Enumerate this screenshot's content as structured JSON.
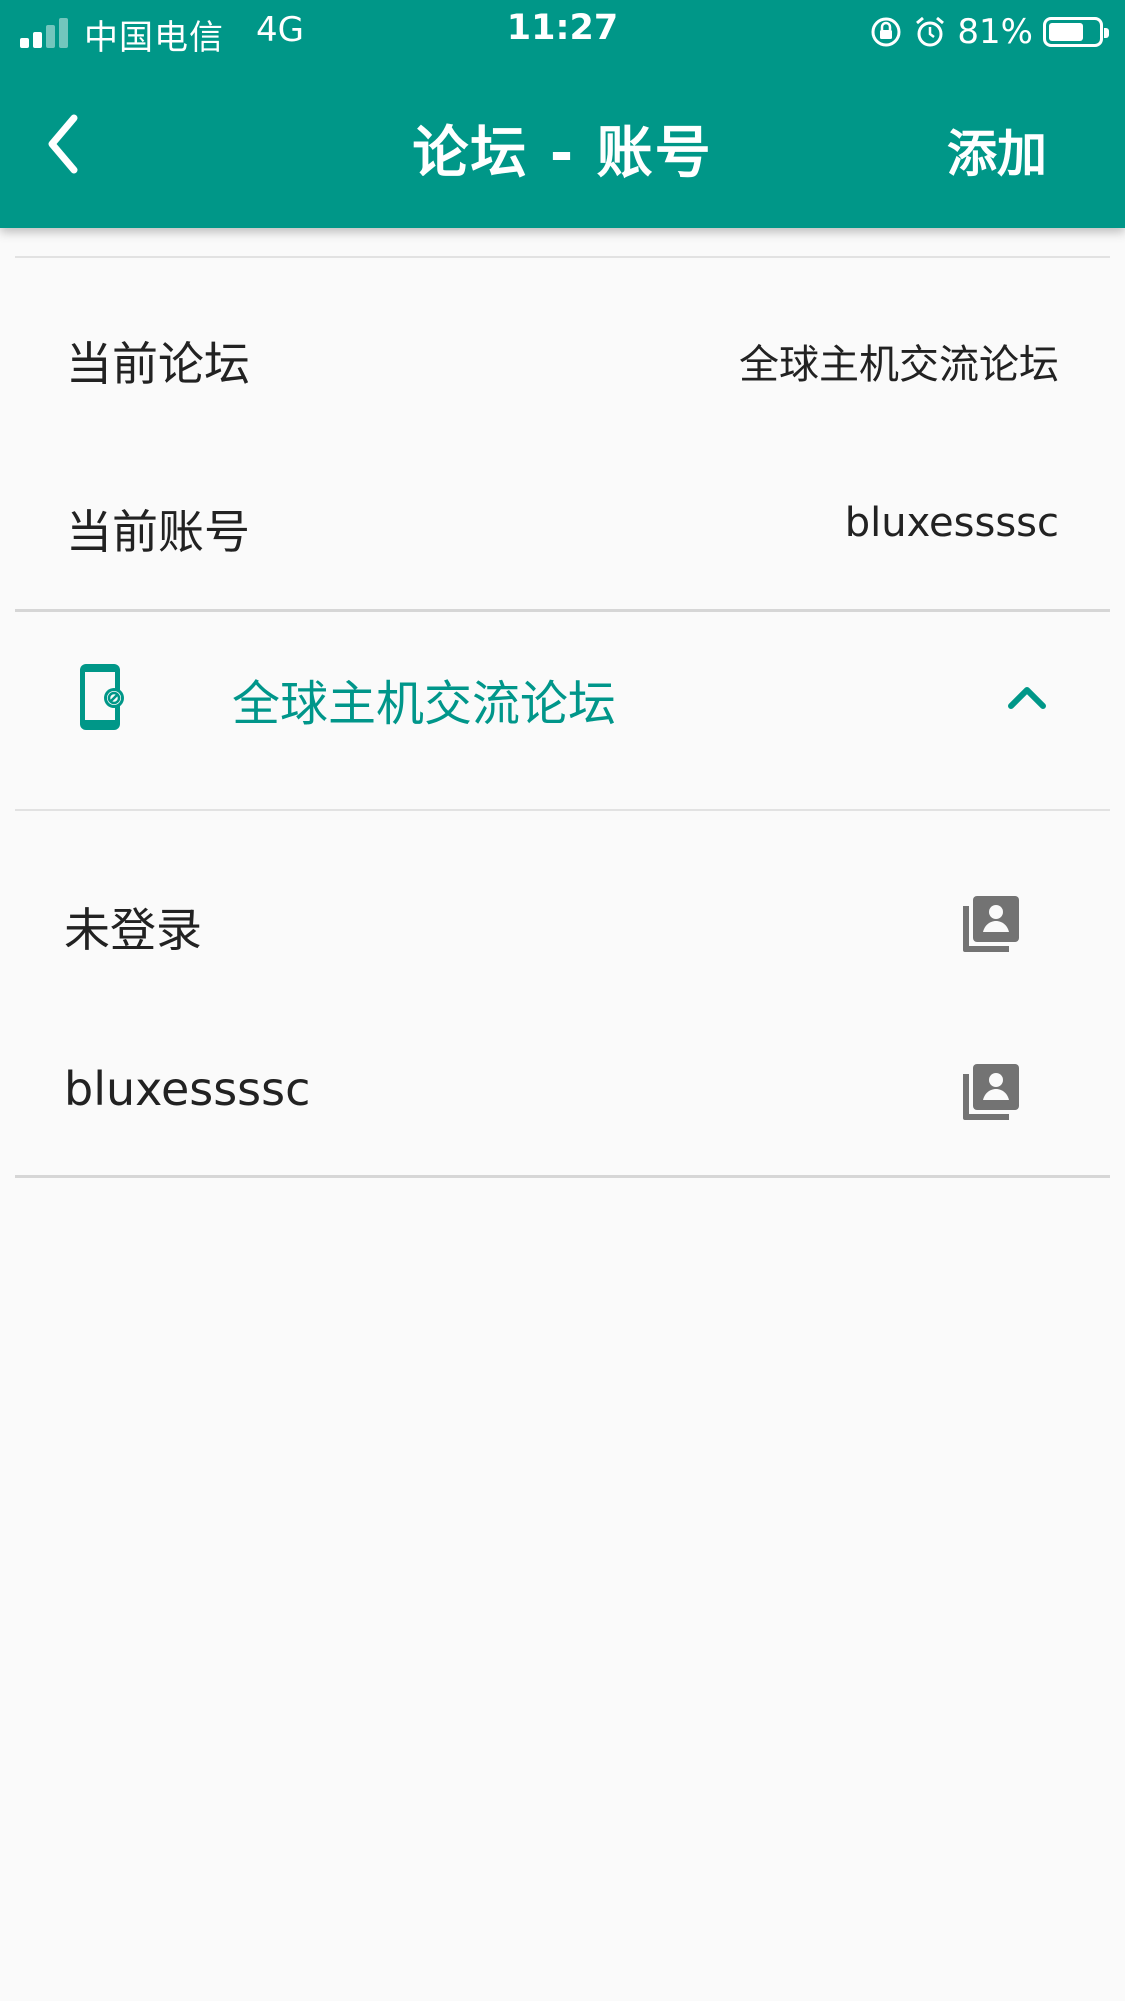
{
  "status_bar": {
    "carrier": "中国电信",
    "network": "4G",
    "time": "11:27",
    "battery_percent": "81%",
    "battery_level": 0.81
  },
  "nav": {
    "title": "论坛 - 账号",
    "add_label": "添加",
    "back_icon": "chevron-left-icon"
  },
  "current": {
    "forum_label": "当前论坛",
    "forum_value": "全球主机交流论坛",
    "account_label": "当前账号",
    "account_value": "bluxessssc"
  },
  "forum_group": {
    "name": "全球主机交流论坛",
    "icon": "phone-off-icon",
    "expanded": true,
    "accent_color": "#009788"
  },
  "accounts": [
    {
      "name": "未登录",
      "icon": "account-switch-icon"
    },
    {
      "name": "bluxessssc",
      "icon": "account-switch-icon"
    }
  ]
}
